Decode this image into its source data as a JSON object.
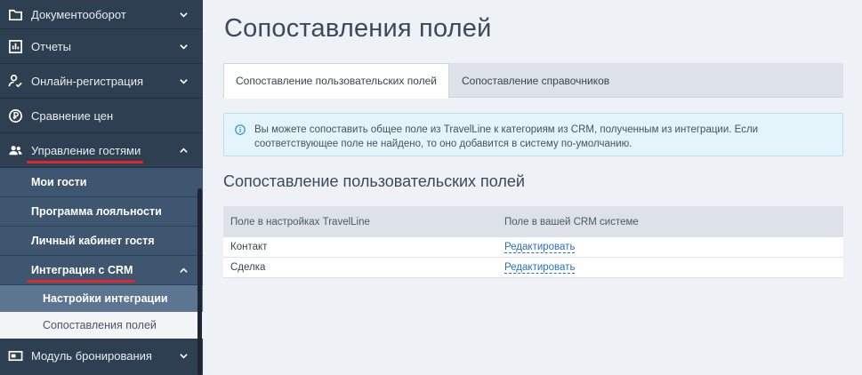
{
  "sidebar": {
    "items": [
      {
        "label": "Документооборот",
        "icon": "folder-icon"
      },
      {
        "label": "Отчеты",
        "icon": "chart-icon"
      },
      {
        "label": "Онлайн-регистрация",
        "icon": "user-check-icon"
      },
      {
        "label": "Сравнение цен",
        "icon": "coin-icon"
      },
      {
        "label": "Управление гостями",
        "icon": "users-icon"
      }
    ],
    "guest_submenu": [
      {
        "label": "Мои гости"
      },
      {
        "label": "Программа лояльности"
      },
      {
        "label": "Личный кабинет гостя"
      },
      {
        "label": "Интеграция с CRM"
      }
    ],
    "crm_submenu": [
      {
        "label": "Настройки интеграции"
      },
      {
        "label": "Сопоставления полей"
      }
    ],
    "booking": {
      "label": "Модуль бронирования",
      "icon": "booking-icon"
    }
  },
  "main": {
    "title": "Сопоставления полей",
    "tabs": [
      {
        "label": "Сопоставление пользовательских полей",
        "active": true
      },
      {
        "label": "Сопоставление справочников",
        "active": false
      }
    ],
    "info_line1": "Вы можете сопоставить общее поле из TravelLine к категориям из CRM, полученным из интеграции. Если",
    "info_line2": "соответствующее поле не найдено, то оно добавится в систему по-умолчанию.",
    "section_title": "Сопоставление пользовательских полей",
    "table": {
      "headers": [
        "Поле в настройках TravelLine",
        "Поле в вашей CRM системе"
      ],
      "rows": [
        {
          "field": "Контакт",
          "action": "Редактировать"
        },
        {
          "field": "Сделка",
          "action": "Редактировать"
        }
      ]
    }
  },
  "colors": {
    "sidebar_bg": "#2e3f52",
    "accent_red": "#e0262d",
    "link": "#2d6fb8"
  }
}
